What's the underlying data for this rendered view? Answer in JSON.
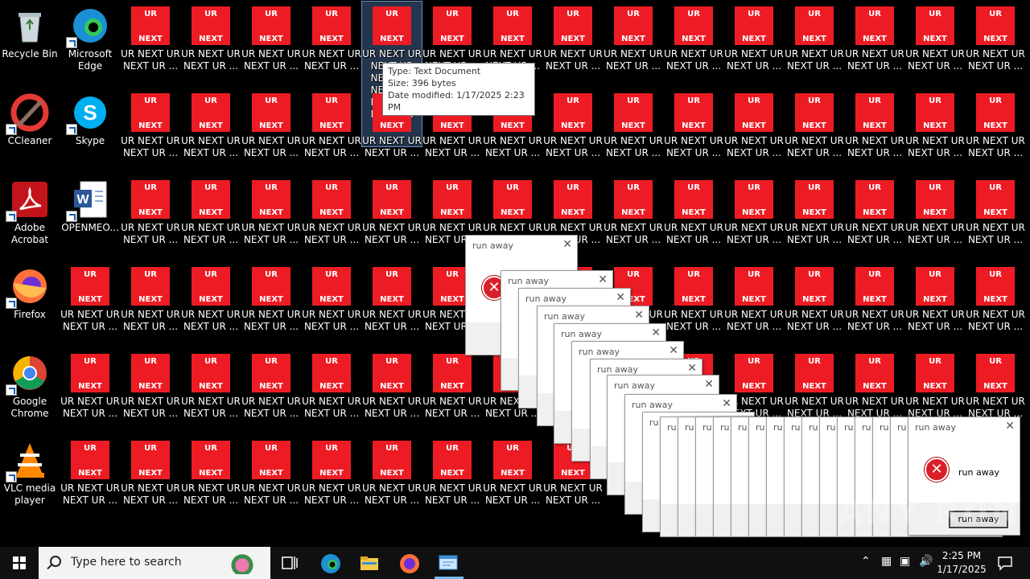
{
  "desktop": {
    "fixed_icons": [
      {
        "name": "recycle-bin",
        "label": "Recycle Bin",
        "col": 0,
        "row": 0,
        "icon": "recycle-bin-icon"
      },
      {
        "name": "microsoft-edge",
        "label": "Microsoft Edge",
        "col": 1,
        "row": 0,
        "icon": "edge-icon"
      },
      {
        "name": "ccleaner",
        "label": "CCleaner",
        "col": 0,
        "row": 1,
        "icon": "ccleaner-icon"
      },
      {
        "name": "skype",
        "label": "Skype",
        "col": 1,
        "row": 1,
        "icon": "skype-icon"
      },
      {
        "name": "adobe-acrobat",
        "label": "Adobe Acrobat",
        "col": 0,
        "row": 2,
        "icon": "acrobat-icon"
      },
      {
        "name": "openmeo",
        "label": "OPENMEO...",
        "col": 1,
        "row": 2,
        "icon": "word-doc-icon"
      },
      {
        "name": "firefox",
        "label": "Firefox",
        "col": 0,
        "row": 3,
        "icon": "firefox-icon"
      },
      {
        "name": "google-chrome",
        "label": "Google Chrome",
        "col": 0,
        "row": 4,
        "icon": "chrome-icon"
      },
      {
        "name": "vlc",
        "label": "VLC media player",
        "col": 0,
        "row": 5,
        "icon": "vlc-icon"
      }
    ],
    "ur_icon": {
      "top_text": "UR",
      "bottom_text": "NEXT",
      "label_line1": "UR NEXT UR",
      "label_line2": "NEXT UR ..."
    },
    "selected_icon_label": "UR NEXT UR NEXT UR NEXT UR NEXT UR NEXT UR NEXT UR",
    "tooltip": {
      "type": "Type: Text Document",
      "size": "Size: 396 bytes",
      "modified": "Date modified: 1/17/2025 2:23 PM"
    },
    "dialog": {
      "title": "run away",
      "message": "run away",
      "button": "run away",
      "stub_title": "ru"
    },
    "watermark": "ANY RUN"
  },
  "taskbar": {
    "search_placeholder": "Type here to search",
    "time": "2:25 PM",
    "date": "1/17/2025"
  },
  "colors": {
    "ur_red": "#ed1c24",
    "taskbar": "#101010",
    "accent": "#76b9ed"
  }
}
